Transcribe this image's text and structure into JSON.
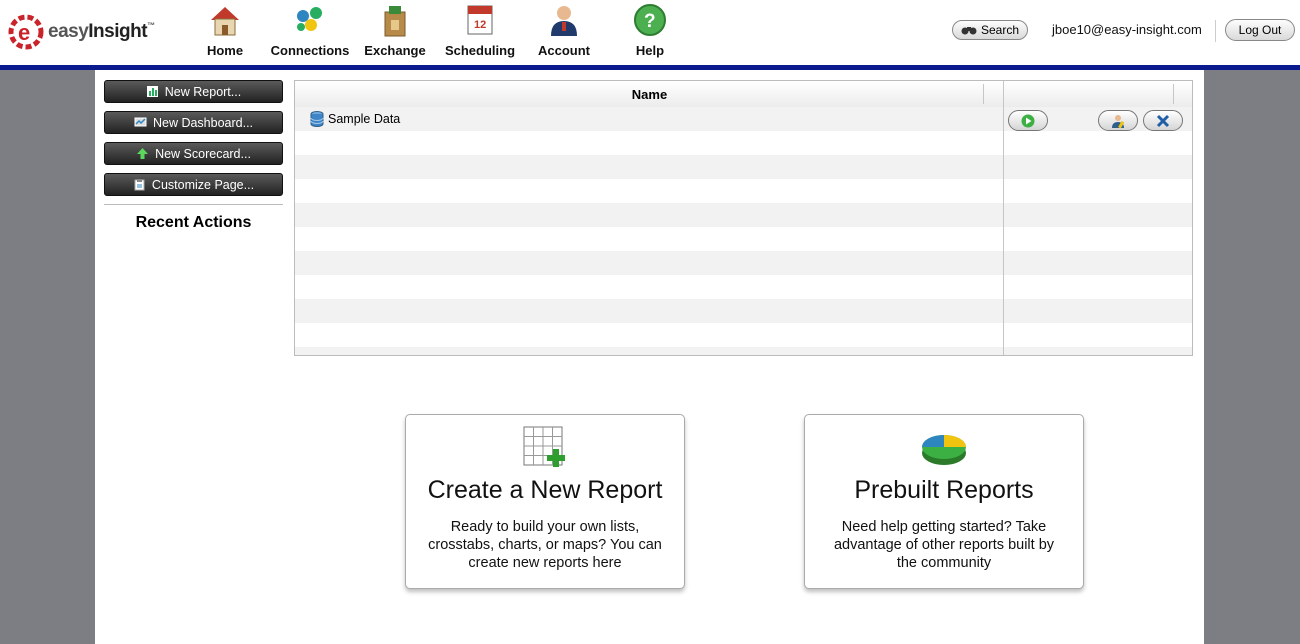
{
  "header": {
    "logo": {
      "brand_easy": "easy",
      "brand_insight": "Insight",
      "trademark": "™"
    },
    "nav": [
      {
        "label": "Home",
        "icon": "home-icon"
      },
      {
        "label": "Connections",
        "icon": "connections-icon"
      },
      {
        "label": "Exchange",
        "icon": "exchange-bag-icon"
      },
      {
        "label": "Scheduling",
        "icon": "calendar-icon"
      },
      {
        "label": "Account",
        "icon": "user-account-icon"
      },
      {
        "label": "Help",
        "icon": "help-question-icon"
      }
    ],
    "search_label": "Search",
    "user_email": "jboe10@easy-insight.com",
    "logout_label": "Log Out",
    "accent_color": "#0b1a8c"
  },
  "sidebar": {
    "buttons": [
      {
        "label": "New Report...",
        "icon": "report-chart-icon"
      },
      {
        "label": "New Dashboard...",
        "icon": "dashboard-icon"
      },
      {
        "label": "New Scorecard...",
        "icon": "scorecard-arrow-icon"
      },
      {
        "label": "Customize Page...",
        "icon": "clipboard-icon"
      }
    ],
    "recent_actions_title": "Recent Actions"
  },
  "grid": {
    "columns": [
      "Name",
      ""
    ],
    "rows": [
      {
        "name": "Sample Data",
        "icon": "database-icon",
        "actions": [
          "play-icon",
          "user-edit-icon",
          "delete-x-icon"
        ]
      }
    ]
  },
  "cards": [
    {
      "title": "Create a New Report",
      "description": "Ready to build your own lists, crosstabs, charts, or maps? You can create new reports here",
      "icon": "grid-plus-icon"
    },
    {
      "title": "Prebuilt Reports",
      "description": "Need help getting started? Take advantage of other reports built by the community",
      "icon": "pie-chart-icon"
    }
  ]
}
